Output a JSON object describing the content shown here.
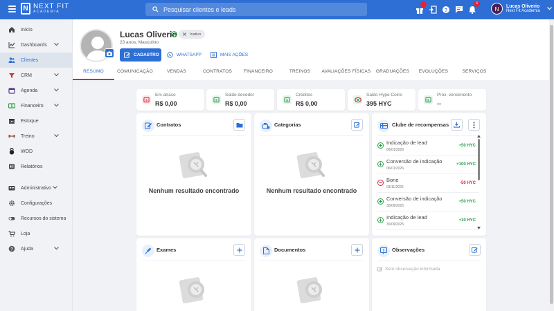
{
  "topbar": {
    "logo_name": "NEXT FIT",
    "logo_sub": "ACADEMIA",
    "search_placeholder": "Pesquisar clientes e leads",
    "notification_count": "4",
    "user_initial": "N",
    "user_name": "Lucas Oliverio",
    "user_company": "Next Fit Academia"
  },
  "sidebar": {
    "items": [
      {
        "label": "Início",
        "icon": "home-icon"
      },
      {
        "label": "Dashboards",
        "icon": "chart-line-icon"
      },
      {
        "label": "Clientes",
        "icon": "users-icon"
      },
      {
        "label": "CRM",
        "icon": "crm-icon"
      },
      {
        "label": "Agenda",
        "icon": "calendar-icon"
      },
      {
        "label": "Financeiro",
        "icon": "money-icon"
      },
      {
        "label": "Estoque",
        "icon": "box-icon"
      },
      {
        "label": "Treino",
        "icon": "dumbbell-icon"
      },
      {
        "label": "WOD",
        "icon": "kettlebell-icon"
      },
      {
        "label": "Relatórios",
        "icon": "report-icon"
      },
      {
        "label": "Administrativo",
        "icon": "id-card-icon"
      },
      {
        "label": "Configurações",
        "icon": "gear-icon"
      },
      {
        "label": "Recursos do sistema",
        "icon": "toggle-icon"
      },
      {
        "label": "Loja",
        "icon": "cart-icon"
      },
      {
        "label": "Ajuda",
        "icon": "help-icon"
      }
    ]
  },
  "profile": {
    "name": "Lucas Oliverio",
    "status": "Inativo",
    "subtitle": "23 anos, Masculino",
    "btn_cadastro": "CADASTRO",
    "btn_whatsapp": "WHATSAPP",
    "btn_mais": "MAIS AÇÕES",
    "tabs": [
      "Resumo",
      "Comunicação",
      "Vendas",
      "Contratos",
      "Financeiro",
      "Treinos",
      "Avaliações físicas",
      "Graduações",
      "Evoluções",
      "Serviços"
    ]
  },
  "stats": [
    {
      "label": "Em atraso",
      "value": "R$ 0,00",
      "color": "#e0243a"
    },
    {
      "label": "Saldo devedor",
      "value": "R$ 0,00",
      "color": "#2e9e4f"
    },
    {
      "label": "Créditos",
      "value": "R$ 0,00",
      "color": "#2e9e4f"
    },
    {
      "label": "Saldo Hype Coins",
      "value": "395 HYC",
      "color": "#2e9e4f"
    },
    {
      "label": "Próx. vencimento",
      "value": "--",
      "color": "#2e9e4f"
    }
  ],
  "cards": {
    "contratos": {
      "title": "Contratos",
      "empty": "Nenhum resultado encontrado"
    },
    "categorias": {
      "title": "Categorias",
      "empty": "Nenhum resultado encontrado"
    },
    "clube": {
      "title": "Clube de recompensas",
      "rows": [
        {
          "title": "Indicação de lead",
          "date": "06/01/2026",
          "value": "+50 HYC",
          "kind": "plus"
        },
        {
          "title": "Conversão de indicação",
          "date": "06/01/2026",
          "value": "+100 HYC",
          "kind": "plus"
        },
        {
          "title": "Bone",
          "date": "03/11/2025",
          "value": "-50 HYC",
          "kind": "minus"
        },
        {
          "title": "Conversão de indicação",
          "date": "30/09/2025",
          "value": "+50 HYC",
          "kind": "plus"
        },
        {
          "title": "Indicação de lead",
          "date": "30/09/2025",
          "value": "+10 HYC",
          "kind": "plus"
        }
      ]
    },
    "exames": {
      "title": "Exames"
    },
    "documentos": {
      "title": "Documentos"
    },
    "observacoes": {
      "title": "Observações",
      "empty": "Sem observação informada"
    }
  },
  "colors": {
    "primary": "#2e6fd6",
    "danger": "#e0243a",
    "success": "#2e9e4f"
  }
}
